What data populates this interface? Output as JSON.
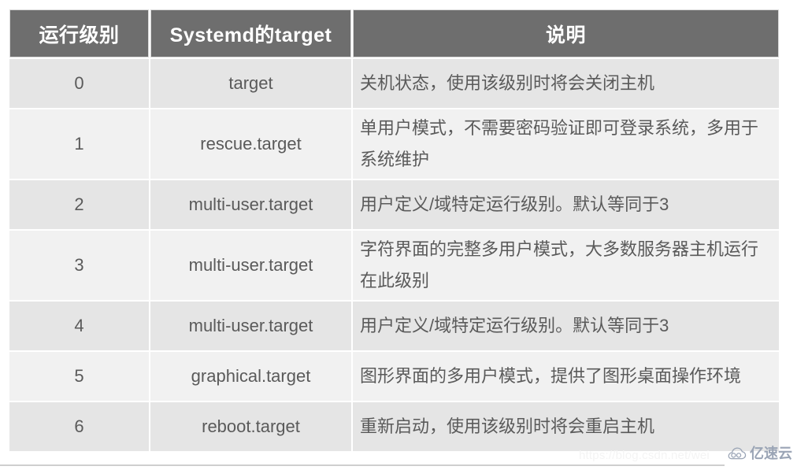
{
  "table": {
    "headers": [
      {
        "label": "运行级别",
        "name": "runlevel"
      },
      {
        "label": "Systemd的target",
        "name": "systemd-target"
      },
      {
        "label": "说明",
        "name": "description"
      }
    ],
    "rows": [
      {
        "level": "0",
        "target": "target",
        "description": "关机状态，使用该级别时将会关闭主机"
      },
      {
        "level": "1",
        "target": "rescue.target",
        "description": "单用户模式，不需要密码验证即可登录系统，多用于系统维护"
      },
      {
        "level": "2",
        "target": "multi-user.target",
        "description": "用户定义/域特定运行级别。默认等同于3"
      },
      {
        "level": "3",
        "target": "multi-user.target",
        "description": "字符界面的完整多用户模式，大多数服务器主机运行在此级别"
      },
      {
        "level": "4",
        "target": "multi-user.target",
        "description": "用户定义/域特定运行级别。默认等同于3"
      },
      {
        "level": "5",
        "target": "graphical.target",
        "description": "图形界面的多用户模式，提供了图形桌面操作环境"
      },
      {
        "level": "6",
        "target": "reboot.target",
        "description": "重新启动，使用该级别时将会重启主机"
      }
    ]
  },
  "watermarks": {
    "csdn_url": "https://blog.csdn.net/wei",
    "brand_text": "亿速云",
    "brand_icon": "cloud-icon"
  },
  "colors": {
    "header_background": "#6e6e6e",
    "header_text": "#ffffff",
    "row_shade": "#e5e5e5",
    "row_light": "#f1f1f1",
    "body_text": "#5a5a5a",
    "brand": "#9aa4b5"
  }
}
